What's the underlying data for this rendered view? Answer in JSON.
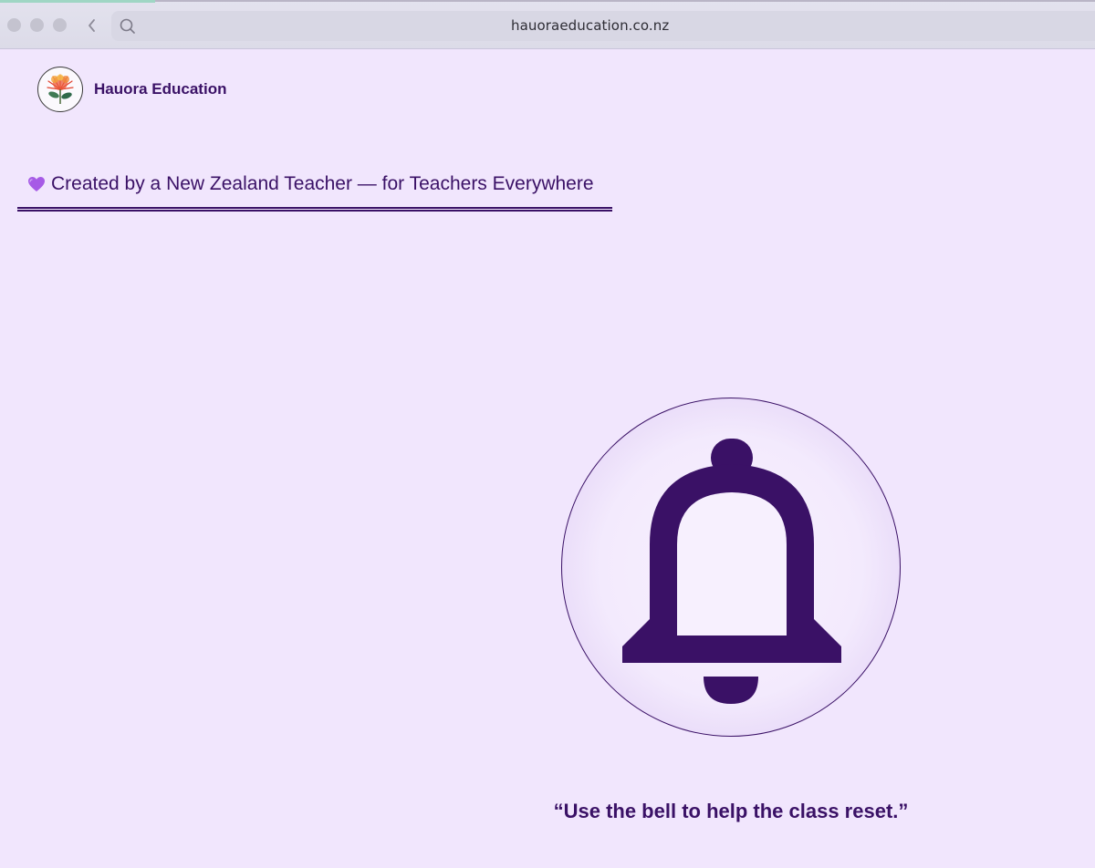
{
  "browser": {
    "url": "hauoraeducation.co.nz"
  },
  "header": {
    "brand_name": "Hauora Education"
  },
  "tagline": {
    "text": "Created by a New Zealand Teacher — for Teachers Everywhere",
    "icon": "purple-heart-icon"
  },
  "bell": {
    "icon": "bell-icon",
    "quote": "“Use the bell to help the class reset.”"
  },
  "colors": {
    "background": "#f1e6fd",
    "primary": "#3a1166"
  }
}
